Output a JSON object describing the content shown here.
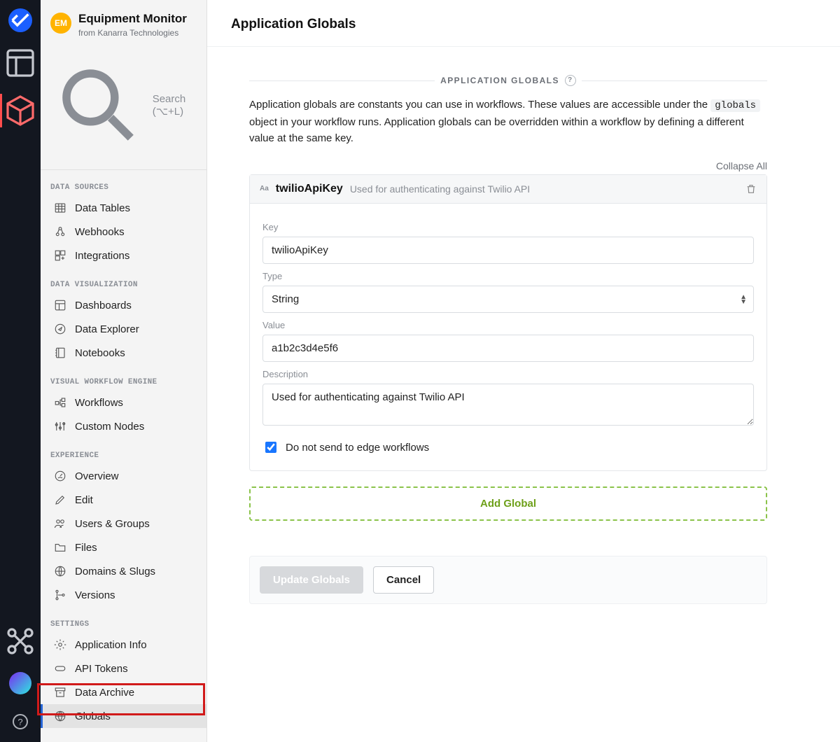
{
  "rail": {
    "icons": [
      "logo",
      "dashboard",
      "package",
      "sitemap"
    ],
    "help_glyph": "?"
  },
  "sidebar": {
    "badge": "EM",
    "title": "Equipment Monitor",
    "subtitle": "from Kanarra Technologies",
    "search_placeholder": "Search (⌥+L)",
    "sections": [
      {
        "title": "DATA SOURCES",
        "items": [
          {
            "icon": "table-icon",
            "label": "Data Tables"
          },
          {
            "icon": "webhook-icon",
            "label": "Webhooks"
          },
          {
            "icon": "integrations-icon",
            "label": "Integrations"
          }
        ]
      },
      {
        "title": "DATA VISUALIZATION",
        "items": [
          {
            "icon": "dashboard-icon",
            "label": "Dashboards"
          },
          {
            "icon": "compass-icon",
            "label": "Data Explorer"
          },
          {
            "icon": "notebook-icon",
            "label": "Notebooks"
          }
        ]
      },
      {
        "title": "VISUAL WORKFLOW ENGINE",
        "items": [
          {
            "icon": "workflow-icon",
            "label": "Workflows"
          },
          {
            "icon": "sliders-icon",
            "label": "Custom Nodes"
          }
        ]
      },
      {
        "title": "EXPERIENCE",
        "items": [
          {
            "icon": "gauge-icon",
            "label": "Overview"
          },
          {
            "icon": "pencil-icon",
            "label": "Edit"
          },
          {
            "icon": "users-icon",
            "label": "Users & Groups"
          },
          {
            "icon": "folder-icon",
            "label": "Files"
          },
          {
            "icon": "globe-icon",
            "label": "Domains & Slugs"
          },
          {
            "icon": "branch-icon",
            "label": "Versions"
          }
        ]
      },
      {
        "title": "SETTINGS",
        "items": [
          {
            "icon": "gear-icon",
            "label": "Application Info"
          },
          {
            "icon": "api-icon",
            "label": "API Tokens"
          },
          {
            "icon": "archive-icon",
            "label": "Data Archive"
          },
          {
            "icon": "globe2-icon",
            "label": "Globals",
            "selected": true
          }
        ]
      }
    ]
  },
  "main": {
    "page_title": "Application Globals",
    "section_heading": "APPLICATION GLOBALS",
    "description_before": "Application globals are constants you can use in workflows. These values are accessible under the ",
    "description_code": "globals",
    "description_after": " object in your workflow runs. Application globals can be overridden within a workflow by defining a different value at the same key.",
    "collapse_label": "Collapse All",
    "card": {
      "aa": "Aa",
      "key_display": "twilioApiKey",
      "desc_display": "Used for authenticating against Twilio API",
      "labels": {
        "key": "Key",
        "type": "Type",
        "value": "Value",
        "description": "Description"
      },
      "key_value": "twilioApiKey",
      "type_value": "String",
      "value_value": "a1b2c3d4e5f6",
      "description_value": "Used for authenticating against Twilio API",
      "checkbox_label": "Do not send to edge workflows",
      "checkbox_checked": true
    },
    "add_button": "Add Global",
    "footer": {
      "primary": "Update Globals",
      "secondary": "Cancel"
    }
  }
}
